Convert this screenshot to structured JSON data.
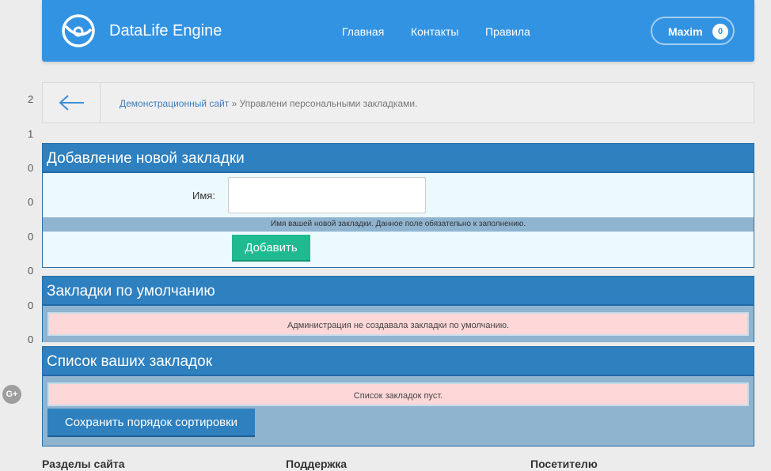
{
  "header": {
    "brand": "DataLife Engine",
    "nav": [
      "Главная",
      "Контакты",
      "Правила"
    ],
    "user": {
      "name": "Maxim",
      "badge": "0"
    }
  },
  "side_numbers": [
    "2",
    "1",
    "0",
    "0",
    "0",
    "0",
    "0",
    "0"
  ],
  "breadcrumb": {
    "link": "Демонстрационный сайт",
    "separator": " » ",
    "current": "Управлени персональными закладками."
  },
  "add_panel": {
    "title": "Добавление новой закладки",
    "name_label": "Имя:",
    "name_value": "",
    "hint": "Имя вашей новой закладки. Данное поле обязательно к заполнению.",
    "add_button": "Добавить"
  },
  "default_panel": {
    "title": "Закладки по умолчанию",
    "message": "Администрация не создавала закладки по умолчанию."
  },
  "list_panel": {
    "title": "Список ваших закладок",
    "message": "Список закладок пуст.",
    "save_button": "Сохранить порядок сортировки"
  },
  "social": {
    "gplus": "G+"
  },
  "footer": [
    "Разделы сайта",
    "Поддержка",
    "Посетителю"
  ],
  "colors": {
    "header": "#3393e3",
    "panel_title": "#2e80bf",
    "add_button": "#1fba90",
    "message_bg": "#fed8d9"
  }
}
